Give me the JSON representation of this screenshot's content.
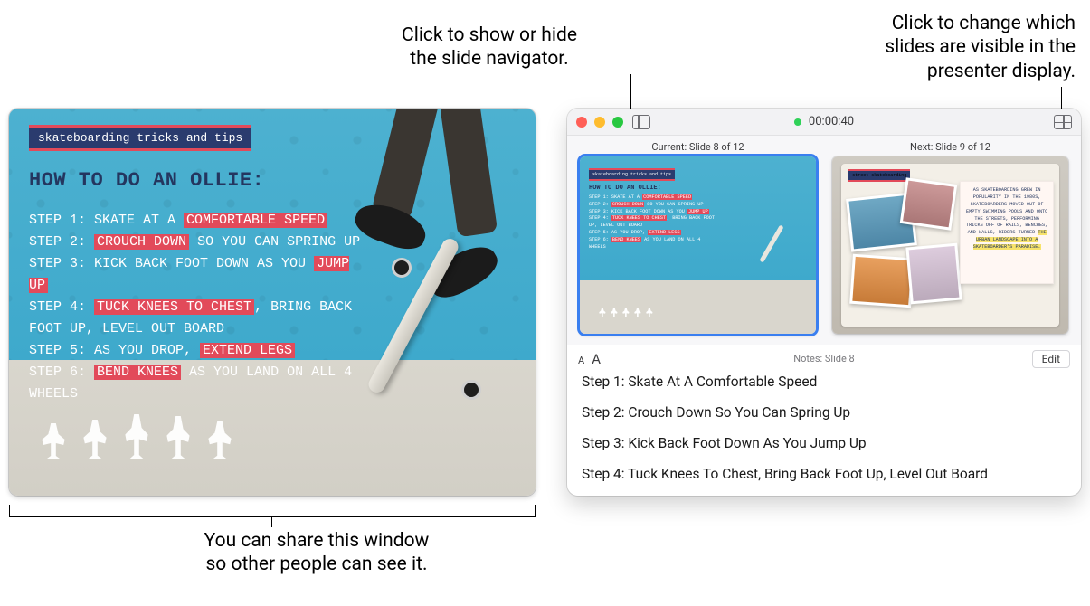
{
  "callouts": {
    "sidebar": "Click to show or hide\nthe slide navigator.",
    "layout": "Click to change which\nslides are visible in the\npresenter display.",
    "share": "You can share this window\nso other people can see it."
  },
  "slide": {
    "badge": "skateboarding tricks and tips",
    "title": "HOW TO DO AN OLLIE:",
    "steps": [
      {
        "label": "STEP 1:",
        "pre": "SKATE AT A ",
        "hl": "COMFORTABLE SPEED",
        "post": ""
      },
      {
        "label": "STEP 2:",
        "pre": "",
        "hl": "CROUCH DOWN",
        "post": " SO YOU CAN SPRING UP"
      },
      {
        "label": "STEP 3:",
        "pre": "KICK BACK FOOT DOWN AS YOU ",
        "hl": "JUMP UP",
        "post": ""
      },
      {
        "label": "STEP 4:",
        "pre": "",
        "hl": "TUCK KNEES TO CHEST",
        "post": ", BRING BACK FOOT UP, LEVEL OUT BOARD"
      },
      {
        "label": "STEP 5:",
        "pre": "AS YOU DROP, ",
        "hl": "EXTEND LEGS",
        "post": ""
      },
      {
        "label": "STEP 6:",
        "pre": "",
        "hl": "BEND KNEES",
        "post": " AS YOU LAND ON ALL 4 WHEELS"
      }
    ]
  },
  "presenter": {
    "timer": "00:00:40",
    "current_label": "Current: Slide 8 of 12",
    "next_label": "Next: Slide 9 of 12",
    "next_badge": "street skateboarding",
    "next_text_pre": "AS SKATEBOARDING GREW IN POPULARITY IN THE 1980S, SKATEBOARDERS MOVED OUT OF EMPTY SWIMMING POOLS AND ONTO THE STREETS, PERFORMING TRICKS OFF OF RAILS, BENCHES, AND WALLS, RIDERS TURNED ",
    "next_text_hl": "THE URBAN LANDSCAPE INTO A SKATEBOARDER'S PARADISE.",
    "notes_header": "Notes: Slide 8",
    "text_size_label_small": "A",
    "text_size_label_big": "A",
    "edit_label": "Edit",
    "notes": [
      "Step 1: Skate At A Comfortable Speed",
      "Step 2: Crouch Down So You Can Spring Up",
      "Step 3: Kick Back Foot Down As You Jump Up",
      "Step 4: Tuck Knees To Chest, Bring Back Foot Up, Level Out Board"
    ]
  }
}
